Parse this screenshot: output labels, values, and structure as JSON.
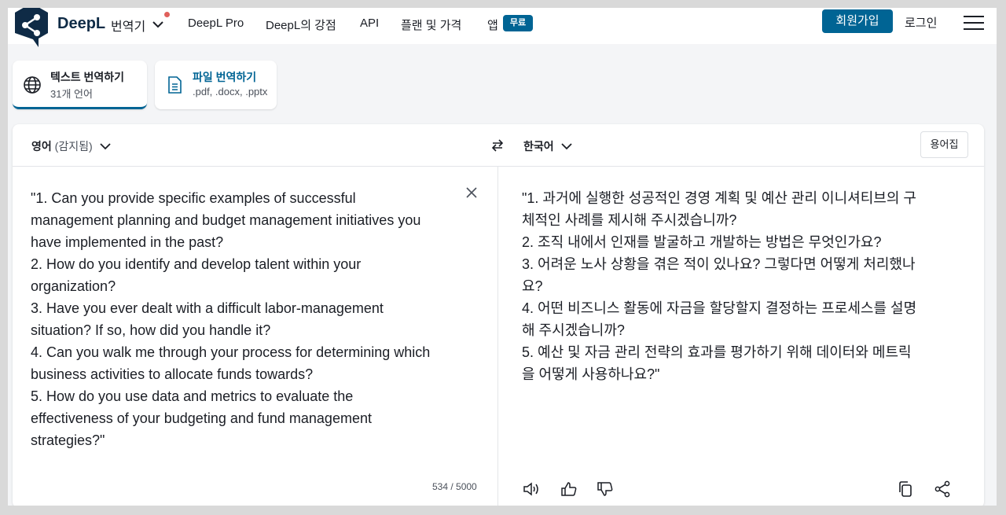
{
  "header": {
    "brand": "DeepL",
    "product": "번역기",
    "nav": [
      "DeepL Pro",
      "DeepL의 강점",
      "API",
      "플랜 및 가격",
      "앱"
    ],
    "badge": "무료",
    "signup": "회원가입",
    "login": "로그인"
  },
  "modes": [
    {
      "title": "텍스트 번역하기",
      "sub": "31개 언어"
    },
    {
      "title": "파일 번역하기",
      "sub": ".pdf, .docx, .pptx"
    }
  ],
  "source": {
    "lang": "영어",
    "detected": "(감지됨)",
    "lines": [
      "\"1. Can you provide specific examples of successful",
      "management planning and budget management initiatives you",
      "have implemented in the past?",
      "2. How do you identify and develop talent within your",
      "organization?",
      "3. Have you ever dealt with a difficult labor-management",
      "situation? If so, how did you handle it?",
      "4. Can you walk me through your process for determining which",
      "business activities to allocate funds towards?",
      "5. How do you use data and metrics to evaluate the",
      "effectiveness of your budgeting and fund management",
      "strategies?\""
    ],
    "counter": "534 / 5000"
  },
  "target": {
    "lang": "한국어",
    "glossary": "용어집",
    "lines": [
      "\"1. 과거에 실행한 성공적인 경영 계획 및 예산 관리 이니셔티브의 구",
      "체적인 사례를 제시해 주시겠습니까?",
      "2. 조직 내에서 인재를 발굴하고 개발하는 방법은 무엇인가요?",
      "3. 어려운 노사 상황을 겪은 적이 있나요? 그렇다면 어떻게 처리했나",
      "요?",
      "4. 어떤 비즈니스 활동에 자금을 할당할지 결정하는 프로세스를 설명",
      "해 주시겠습니까?",
      "5. 예산 및 자금 관리 전략의 효과를 평가하기 위해 데이터와 메트릭",
      "을 어떻게 사용하나요?\""
    ]
  },
  "colors": {
    "accent": "#006494",
    "brand_dark": "#0f2b46"
  }
}
